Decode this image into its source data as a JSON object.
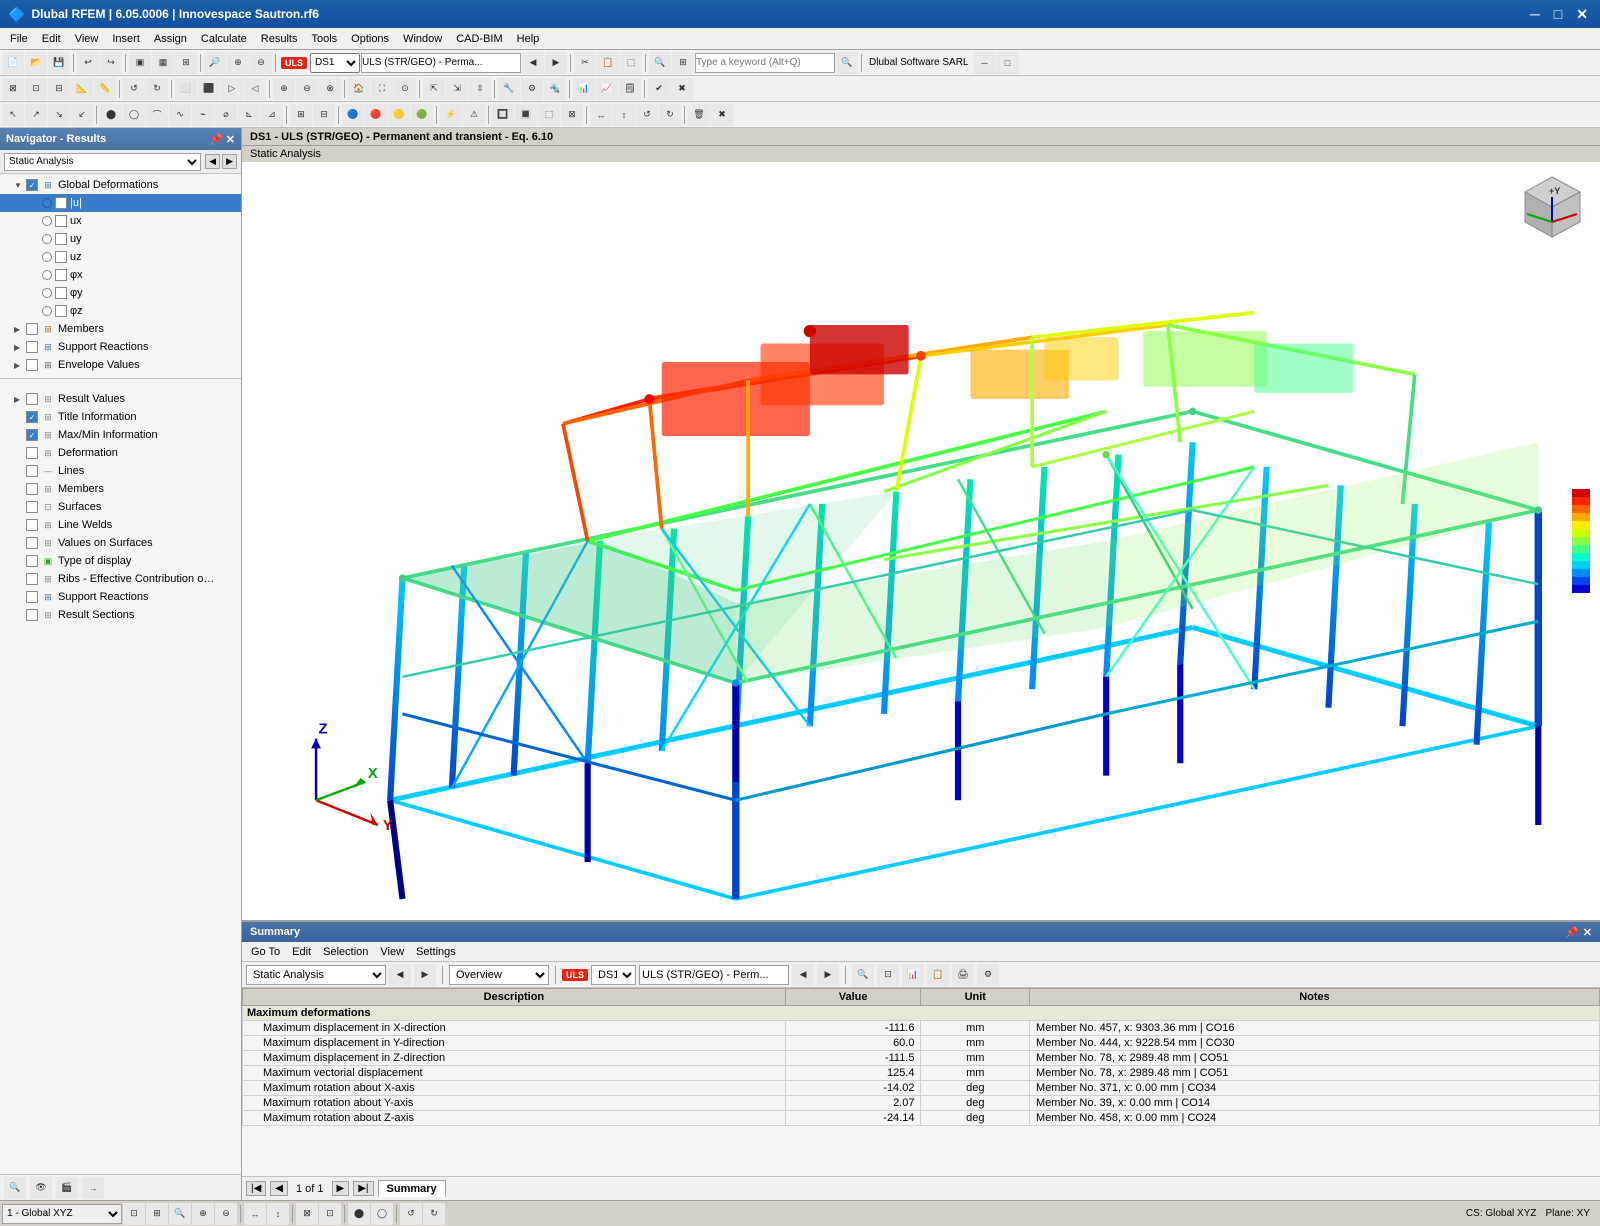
{
  "titlebar": {
    "title": "Dlubal RFEM | 6.05.0006 | Innovespace Sautron.rf6",
    "icon": "dlubal-icon",
    "minimize_label": "─",
    "maximize_label": "□",
    "close_label": "✕"
  },
  "menubar": {
    "items": [
      "File",
      "Edit",
      "View",
      "Insert",
      "Assign",
      "Calculate",
      "Results",
      "Tools",
      "Options",
      "Window",
      "CAD-BIM",
      "Help"
    ]
  },
  "navigator": {
    "title": "Navigator - Results",
    "analysis_options": [
      "Static Analysis"
    ],
    "selected_analysis": "Static Analysis",
    "tree": {
      "global_deformations": {
        "label": "Global Deformations",
        "expanded": true,
        "checked": true,
        "items": [
          {
            "label": "|u|",
            "selected": true,
            "radio": true
          },
          {
            "label": "ux",
            "radio": true
          },
          {
            "label": "uy",
            "radio": true
          },
          {
            "label": "uz",
            "radio": true
          },
          {
            "label": "φx",
            "radio": true
          },
          {
            "label": "φy",
            "radio": true
          },
          {
            "label": "φz",
            "radio": true
          }
        ]
      },
      "members": {
        "label": "Members",
        "expanded": false
      },
      "support_reactions": {
        "label": "Support Reactions",
        "expanded": false
      },
      "envelope_values": {
        "label": "Envelope Values",
        "expanded": false
      },
      "bottom_items": [
        {
          "label": "Result Values"
        },
        {
          "label": "Title Information",
          "checked": true
        },
        {
          "label": "Max/Min Information",
          "checked": true
        },
        {
          "label": "Deformation"
        },
        {
          "label": "Lines"
        },
        {
          "label": "Members"
        },
        {
          "label": "Surfaces"
        },
        {
          "label": "Line Welds"
        },
        {
          "label": "Values on Surfaces"
        },
        {
          "label": "Type of display"
        },
        {
          "label": "Ribs - Effective Contribution on Surfac..."
        },
        {
          "label": "Support Reactions"
        },
        {
          "label": "Result Sections"
        }
      ]
    }
  },
  "view_header": {
    "title": "DS1 - ULS (STR/GEO) - Permanent and transient - Eq. 6.10",
    "subtitle": "Static Analysis"
  },
  "summary": {
    "title": "Summary",
    "menu_items": [
      "Go To",
      "Edit",
      "Selection",
      "View",
      "Settings"
    ],
    "analysis_select": "Static Analysis",
    "overview_select": "Overview",
    "load_combo_badge": "ULS",
    "load_combo_label": "DS1",
    "load_combo_desc": "ULS (STR/GEO) - Perm...",
    "table": {
      "headers": [
        "Description",
        "Value",
        "Unit",
        "Notes"
      ],
      "sections": [
        {
          "section_label": "Maximum deformations",
          "rows": [
            {
              "desc": "Maximum displacement in X-direction",
              "value": "-111.6",
              "unit": "mm",
              "note": "Member No. 457, x: 9303.36 mm | CO16"
            },
            {
              "desc": "Maximum displacement in Y-direction",
              "value": "60.0",
              "unit": "mm",
              "note": "Member No. 444, x: 9228.54 mm | CO30"
            },
            {
              "desc": "Maximum displacement in Z-direction",
              "value": "-111.5",
              "unit": "mm",
              "note": "Member No. 78, x: 2989.48 mm | CO51"
            },
            {
              "desc": "Maximum vectorial displacement",
              "value": "125.4",
              "unit": "mm",
              "note": "Member No. 78, x: 2989.48 mm | CO51"
            },
            {
              "desc": "Maximum rotation about X-axis",
              "value": "-14.02",
              "unit": "deg",
              "note": "Member No. 371, x: 0.00 mm | CO34"
            },
            {
              "desc": "Maximum rotation about Y-axis",
              "value": "2.07",
              "unit": "deg",
              "note": "Member No. 39, x: 0.00 mm | CO14"
            },
            {
              "desc": "Maximum rotation about Z-axis",
              "value": "-24.14",
              "unit": "deg",
              "note": "Member No. 458, x: 0.00 mm | CO24"
            }
          ]
        }
      ]
    },
    "footer": {
      "page_info": "1 of 1",
      "tab_label": "Summary"
    }
  },
  "statusbar": {
    "coord_system": "1 - Global XYZ",
    "cs_label": "CS: Global XYZ",
    "plane_label": "Plane: XY"
  },
  "legend": {
    "colors": [
      "#0000cc",
      "#0044ee",
      "#0088ff",
      "#00ccff",
      "#00ffcc",
      "#44ff88",
      "#88ff44",
      "#ccff00",
      "#ffee00",
      "#ffaa00",
      "#ff6600",
      "#ff2200",
      "#cc0000"
    ]
  },
  "axis": {
    "x_label": "X",
    "y_label": "Y",
    "z_label": "Z"
  }
}
